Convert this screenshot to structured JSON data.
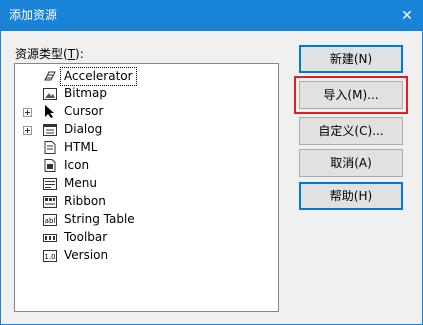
{
  "window": {
    "title": "添加资源",
    "close_glyph": "✕"
  },
  "resource_label": {
    "text": "资源类型",
    "mnemonic": "T"
  },
  "tree_items": [
    {
      "label": "Accelerator",
      "icon": "accelerator-icon",
      "expandable": false,
      "selected": true
    },
    {
      "label": "Bitmap",
      "icon": "bitmap-icon",
      "expandable": false,
      "selected": false
    },
    {
      "label": "Cursor",
      "icon": "cursor-icon",
      "expandable": true,
      "selected": false
    },
    {
      "label": "Dialog",
      "icon": "dialog-icon",
      "expandable": true,
      "selected": false
    },
    {
      "label": "HTML",
      "icon": "html-icon",
      "expandable": false,
      "selected": false
    },
    {
      "label": "Icon",
      "icon": "icon-resource-icon",
      "expandable": false,
      "selected": false
    },
    {
      "label": "Menu",
      "icon": "menu-icon",
      "expandable": false,
      "selected": false
    },
    {
      "label": "Ribbon",
      "icon": "ribbon-icon",
      "expandable": false,
      "selected": false
    },
    {
      "label": "String Table",
      "icon": "string-table-icon",
      "expandable": false,
      "selected": false
    },
    {
      "label": "Toolbar",
      "icon": "toolbar-icon",
      "expandable": false,
      "selected": false
    },
    {
      "label": "Version",
      "icon": "version-icon",
      "expandable": false,
      "selected": false
    }
  ],
  "buttons": {
    "new": "新建(N)",
    "import": "导入(M)...",
    "custom": "自定义(C)...",
    "cancel": "取消(A)",
    "help": "帮助(H)"
  },
  "colors": {
    "titlebar": "#1883d7",
    "highlight_box": "#e02020",
    "default_button_border": "#0078d7"
  }
}
